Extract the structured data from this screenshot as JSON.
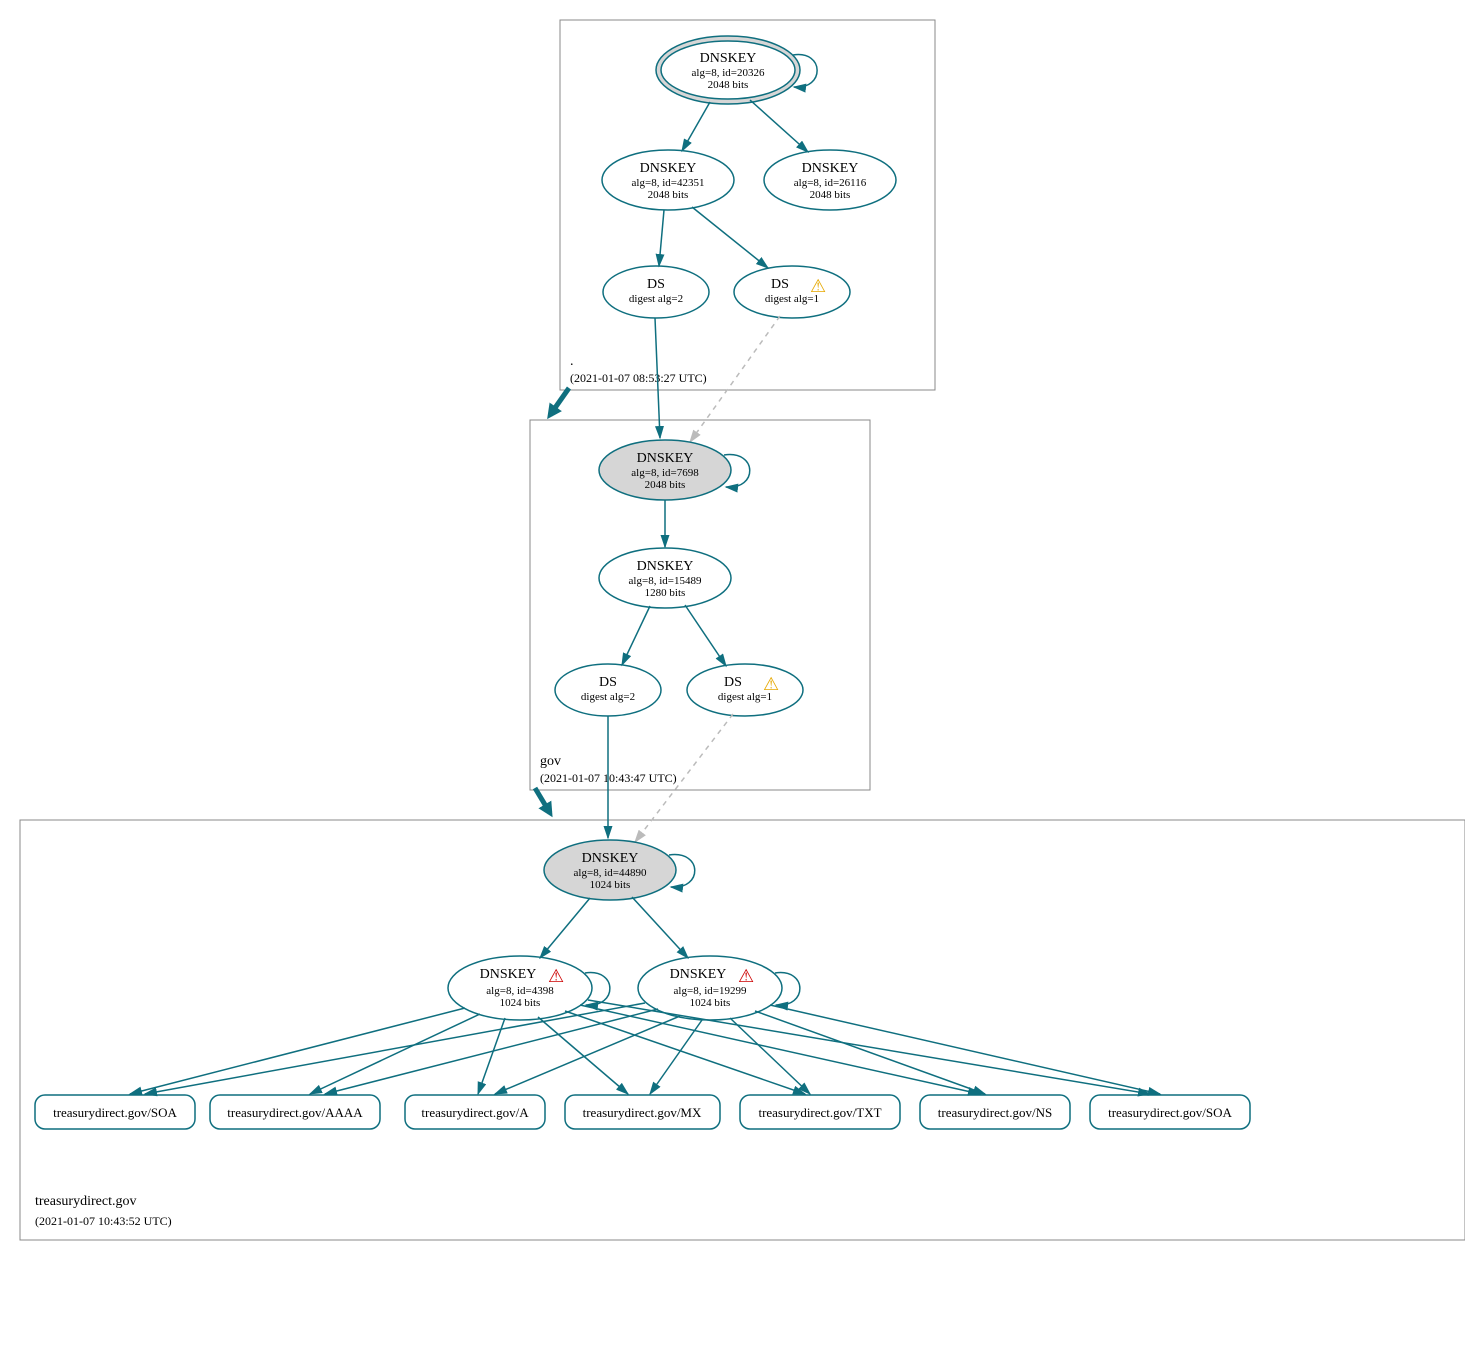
{
  "zones": {
    "root": {
      "name": ".",
      "timestamp": "(2021-01-07 08:53:27 UTC)"
    },
    "gov": {
      "name": "gov",
      "timestamp": "(2021-01-07 10:43:47 UTC)"
    },
    "td": {
      "name": "treasurydirect.gov",
      "timestamp": "(2021-01-07 10:43:52 UTC)"
    }
  },
  "nodes": {
    "root_ksk": {
      "title": "DNSKEY",
      "line2": "alg=8, id=20326",
      "line3": "2048 bits"
    },
    "root_zsk1": {
      "title": "DNSKEY",
      "line2": "alg=8, id=42351",
      "line3": "2048 bits"
    },
    "root_zsk2": {
      "title": "DNSKEY",
      "line2": "alg=8, id=26116",
      "line3": "2048 bits"
    },
    "root_ds1": {
      "title": "DS",
      "line2": "digest alg=2"
    },
    "root_ds2": {
      "title": "DS",
      "line2": "digest alg=1"
    },
    "gov_ksk": {
      "title": "DNSKEY",
      "line2": "alg=8, id=7698",
      "line3": "2048 bits"
    },
    "gov_zsk": {
      "title": "DNSKEY",
      "line2": "alg=8, id=15489",
      "line3": "1280 bits"
    },
    "gov_ds1": {
      "title": "DS",
      "line2": "digest alg=2"
    },
    "gov_ds2": {
      "title": "DS",
      "line2": "digest alg=1"
    },
    "td_ksk": {
      "title": "DNSKEY",
      "line2": "alg=8, id=44890",
      "line3": "1024 bits"
    },
    "td_zsk1": {
      "title": "DNSKEY",
      "line2": "alg=8, id=4398",
      "line3": "1024 bits"
    },
    "td_zsk2": {
      "title": "DNSKEY",
      "line2": "alg=8, id=19299",
      "line3": "1024 bits"
    }
  },
  "rr": {
    "soa1": "treasurydirect.gov/SOA",
    "aaaa": "treasurydirect.gov/AAAA",
    "a": "treasurydirect.gov/A",
    "mx": "treasurydirect.gov/MX",
    "txt": "treasurydirect.gov/TXT",
    "ns": "treasurydirect.gov/NS",
    "soa2": "treasurydirect.gov/SOA"
  },
  "icons": {
    "warn_yellow": "⚠",
    "warn_red": "⚠"
  }
}
